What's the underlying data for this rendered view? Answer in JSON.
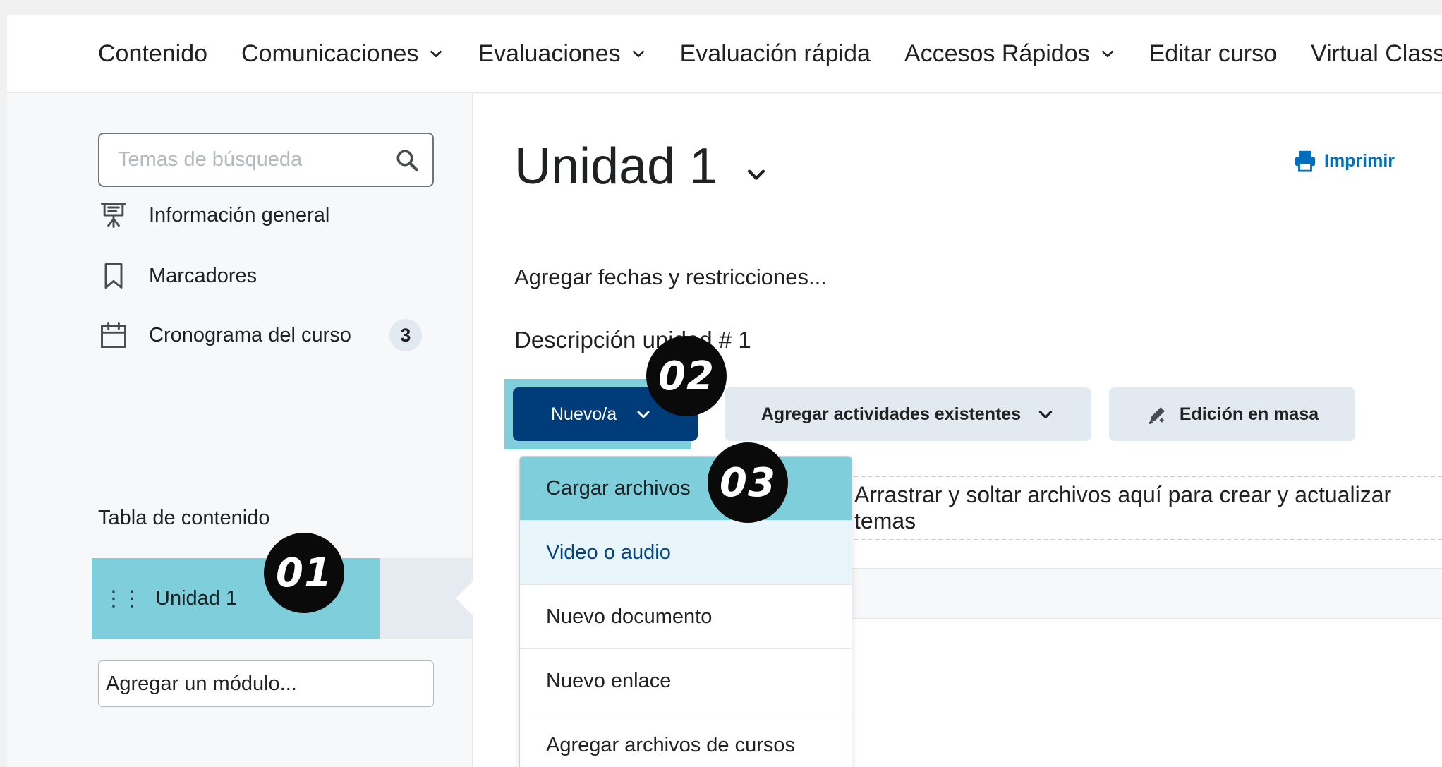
{
  "nav": {
    "items": [
      {
        "label": "Contenido",
        "has_menu": false
      },
      {
        "label": "Comunicaciones",
        "has_menu": true
      },
      {
        "label": "Evaluaciones",
        "has_menu": true
      },
      {
        "label": "Evaluación rápida",
        "has_menu": false
      },
      {
        "label": "Accesos Rápidos",
        "has_menu": true
      },
      {
        "label": "Editar curso",
        "has_menu": false
      },
      {
        "label": "Virtual Class",
        "has_menu": false
      }
    ]
  },
  "sidebar": {
    "search_placeholder": "Temas de búsqueda",
    "links": [
      {
        "label": "Información general",
        "icon": "presentation-icon"
      },
      {
        "label": "Marcadores",
        "icon": "bookmark-icon"
      },
      {
        "label": "Cronograma del curso",
        "icon": "calendar-icon",
        "badge": "3"
      }
    ],
    "toc_label": "Tabla de contenido",
    "selected_unit": "Unidad 1",
    "add_module": "Agregar un módulo..."
  },
  "main": {
    "title": "Unidad 1",
    "print_label": "Imprimir",
    "dates_link": "Agregar fechas y restricciones...",
    "description": "Descripción unidad # 1",
    "new_button": "Nuevo/a",
    "existing_button": "Agregar actividades existentes",
    "bulk_button": "Edición en masa",
    "dropzone_text": "Arrastrar y soltar archivos aquí para crear y actualizar temas"
  },
  "dropdown": {
    "items": [
      {
        "label": "Cargar archivos",
        "state": "selected"
      },
      {
        "label": "Video o audio",
        "state": "hover"
      },
      {
        "label": "Nuevo documento",
        "state": "normal"
      },
      {
        "label": "Nuevo enlace",
        "state": "normal"
      },
      {
        "label": "Agregar archivos de cursos",
        "state": "normal"
      }
    ]
  },
  "callouts": {
    "one": "01",
    "two": "02",
    "three": "03"
  },
  "colors": {
    "highlight": "#7ecfdb",
    "primary_button": "#003b7a",
    "link": "#006fbf"
  }
}
